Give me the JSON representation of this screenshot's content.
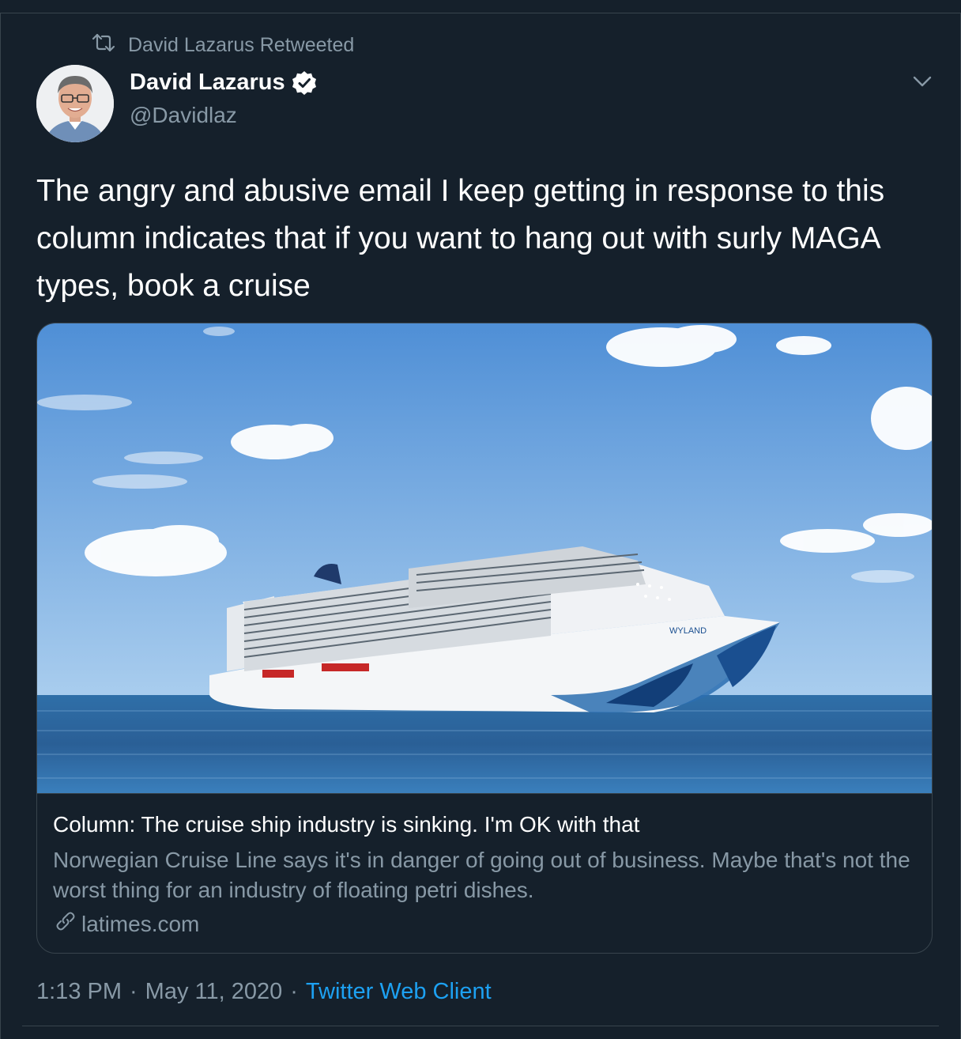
{
  "retweet": {
    "icon": "retweet-icon",
    "label": "David Lazarus Retweeted"
  },
  "author": {
    "name": "David Lazarus",
    "handle": "@Davidlaz",
    "verified": true
  },
  "tweet": {
    "text": "The angry and abusive email I keep getting in response to this column indicates that if you want to hang out with surly MAGA types, book a cruise"
  },
  "card": {
    "image_alt": "Cruise ship at sea",
    "ship_art_label": "WYLAND",
    "title": "Column: The cruise ship industry is sinking. I'm OK with that",
    "description": "Norwegian Cruise Line says it's in danger of going out of business. Maybe that's not the worst thing for an industry of floating petri dishes.",
    "domain": "latimes.com"
  },
  "meta": {
    "time": "1:13 PM",
    "separator": "·",
    "date": "May 11, 2020",
    "client": "Twitter Web Client"
  },
  "colors": {
    "background": "#15202b",
    "muted": "#8899a6",
    "accent": "#1da1f2",
    "border": "#38444d"
  }
}
